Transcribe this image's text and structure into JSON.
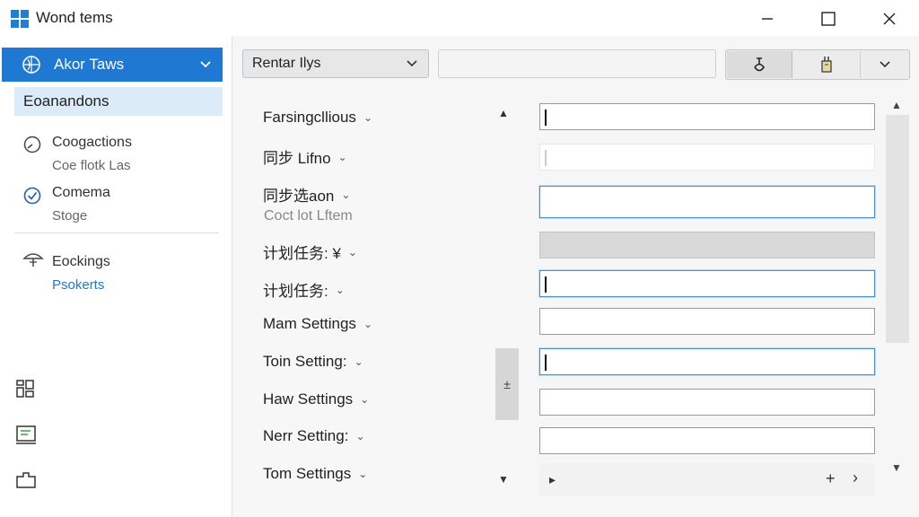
{
  "window": {
    "title": "Wond tems",
    "minimize_glyph": "—",
    "maximize_glyph": "☐",
    "close_glyph": "✕"
  },
  "sidebar": {
    "header_label": "Akor Taws",
    "selected_item": "Eoanandons",
    "items": [
      {
        "label": "Coogactions",
        "sub": "Coe flotk Las",
        "icon": "gauge-icon"
      },
      {
        "label": "Comema",
        "sub": "Stoge",
        "icon": "check-circle-icon"
      },
      {
        "label": "Eockings",
        "link": "Psokerts",
        "icon": "umbrella-icon"
      }
    ],
    "bottom_icons": [
      "dashboard-icon",
      "monitor-icon",
      "folder-icon"
    ]
  },
  "toolbar": {
    "dropdown_value": "Rentar Ilys",
    "search_value": ""
  },
  "settings_list": {
    "items": [
      {
        "label": "Farsingcllious"
      },
      {
        "label": "同步 Lifno"
      },
      {
        "label": "同步选aon",
        "sub": "Coct lot Lftem"
      },
      {
        "label": "计划任务: ¥"
      },
      {
        "label": "计划任务:"
      },
      {
        "label": "Mam Settings"
      },
      {
        "label": "Toin Setting:"
      },
      {
        "label": "Haw Settings"
      },
      {
        "label": "Nerr Setting:"
      },
      {
        "label": "Tom Settings"
      }
    ],
    "scroll_up_glyph": "▲",
    "scroll_down_glyph": "▼",
    "thumb_glyph": "±"
  },
  "fields": {
    "values": [
      "",
      "",
      "",
      "",
      "",
      "",
      "",
      "",
      "",
      ""
    ]
  },
  "bottom_bar": {
    "play_glyph": "▸",
    "plus_glyph": "+",
    "next_glyph": "›"
  },
  "right_scroll": {
    "up_glyph": "▲",
    "down_glyph": "▼"
  },
  "colors": {
    "accent": "#1f78d1",
    "selected_bg": "#dcebf8",
    "focus_border": "#4a90c8"
  }
}
